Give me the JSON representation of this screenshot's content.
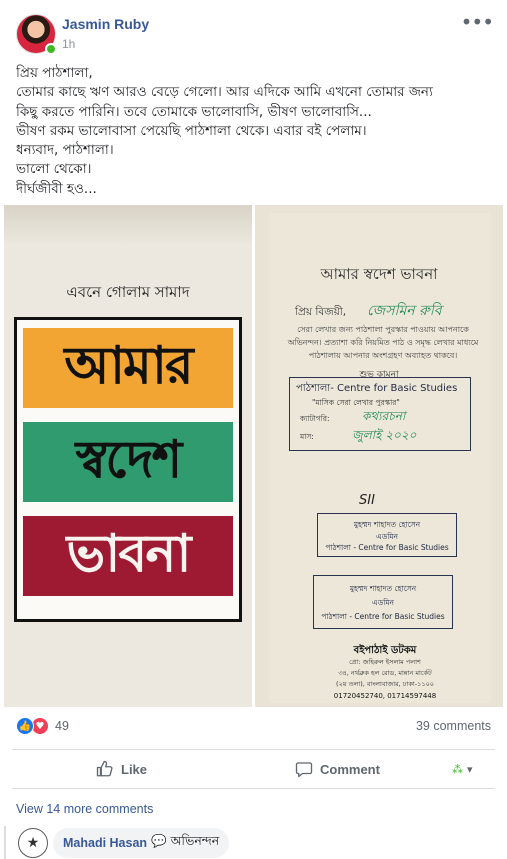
{
  "post": {
    "author": "Jasmin Ruby",
    "time": "1h",
    "more_icon": "•••",
    "text_lines": [
      "প্রিয় পাঠশালা,",
      "তোমার কাছে ঋণ আরও বেড়ে গেলো। আর এদিকে আমি এখনো তোমার জন্য",
      "কিছু করতে পারিনি। তবে তোমাকে ভালোবাসি, ভীষণ ভালোবাসি...",
      "ভীষণ রকম ভালোবাসা পেয়েছি পাঠশালা থেকে। এবার বই পেলাম।",
      "ধন্যবাদ, পাঠশালা।",
      "ভালো থেকো।",
      "দীর্ঘজীবী হও..."
    ]
  },
  "photo_left": {
    "author_line": "এবনে গোলাম সামাদ",
    "title_words": [
      "আমার",
      "স্বদেশ",
      "ভাবনা"
    ]
  },
  "photo_right": {
    "title": "আমার স্বদেশ ভাবনা",
    "dear": "প্রিয় বিজয়ী,",
    "winner_name": "জেসমিন রুবি",
    "body": "সেরা লেখার জন্য পাঠশালা পুরস্কার পাওয়ায় আপনাকে অভিনন্দন। প্রত্যাশা করি নিয়মিত পাঠ ও সমৃদ্ধ লেখার মাধ্যমে পাঠশালায় আপনার অংশগ্রহণ অব্যাহত থাকবে।",
    "greeting": "শুভ কামনা",
    "stamp_org": "পাঠশালা- Centre for Basic Studies",
    "stamp_award": "\"মাসিক সেরা লেখার পুরস্কার\"",
    "stamp_category_label": "ক্যাটাগরি:",
    "stamp_category": "কথ্যরচনা",
    "stamp_month_label": "মাস:",
    "stamp_month": "জুলাই ২০২০",
    "signature": "SII",
    "seal_name": "মুহম্মদ শাহাদত হোসেন",
    "seal_role": "এডমিন",
    "seal_org": "পাঠশালা - Centre for Basic Studies",
    "footer_org": "বইপাঠাই ডটকম",
    "footer_line1": "প্রো: জহিরুল ইসলাম পলাশ",
    "footer_line2": "৩৪, নর্থব্রুক হল রোড, মান্নান মার্কেট",
    "footer_line3": "(২য় তলা), বাংলাবাজার, ঢাকা-১১০০",
    "footer_phone": "01720452740, 01714597448"
  },
  "stats": {
    "reactions": "49",
    "comments": "39 comments"
  },
  "actions": {
    "like": "Like",
    "comment": "Comment",
    "audience_icon": "⁂",
    "dropdown_icon": "▾"
  },
  "comments": {
    "view_more": "View 14 more comments",
    "items": [
      {
        "author": "Mahadi Hasan",
        "text": "💬 অভিনন্দন"
      }
    ]
  },
  "colors": {
    "link": "#385898",
    "like_blue": "#1877f2",
    "love_red": "#f33e58",
    "online_green": "#42b72a"
  }
}
